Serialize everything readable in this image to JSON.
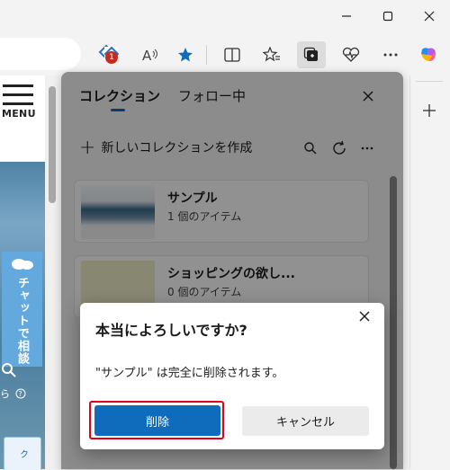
{
  "browser": {
    "window_controls": {
      "minimize_icon": "minimize-icon",
      "maximize_icon": "maximize-icon",
      "close_icon": "close-icon"
    },
    "toolbar": {
      "notification_badge": "1",
      "read_aloud_icon": "read-aloud-icon",
      "favorite_icon": "star-icon",
      "split_screen_icon": "split-screen-icon",
      "favorites_icon": "favorites-icon",
      "collections_icon": "collections-icon",
      "health_icon": "browser-essentials-icon",
      "more_icon": "more-icon",
      "copilot_icon": "copilot-icon"
    },
    "sidebar_add_icon": "plus-icon",
    "accent_color": "#0f6cbd"
  },
  "webpage": {
    "menu_label": "MENU",
    "chat_label": "チャットで相談",
    "help_fragment": "ら",
    "bottom_tab": "ク"
  },
  "collections": {
    "tabs": [
      {
        "label": "コレクション",
        "selected": true
      },
      {
        "label": "フォロー中",
        "selected": false
      }
    ],
    "new_collection_label": "新しいコレクションを作成",
    "items": [
      {
        "title": "サンプル",
        "subtitle": "1 個のアイテム"
      },
      {
        "title": "ショッピングの欲し...",
        "subtitle": "0 個のアイテム"
      }
    ]
  },
  "dialog": {
    "title": "本当によろしいですか?",
    "message": "\"サンプル\" は完全に削除されます。",
    "delete_label": "削除",
    "cancel_label": "キャンセル",
    "highlight_color": "#e0001b"
  }
}
